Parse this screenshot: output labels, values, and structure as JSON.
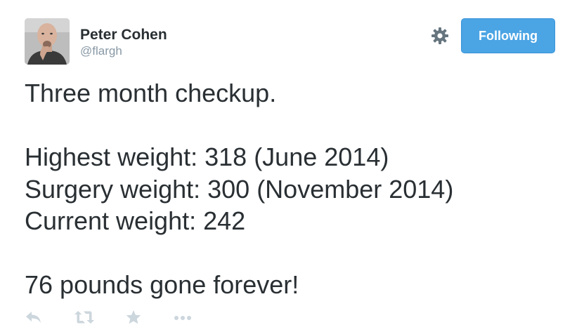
{
  "user": {
    "name": "Peter Cohen",
    "handle": "@flargh"
  },
  "header": {
    "follow_label": "Following",
    "settings_icon": "gear-icon",
    "accent": "#4ba4e4"
  },
  "tweet": {
    "lines": [
      "Three month checkup.",
      "",
      "Highest weight: 318 (June 2014)",
      "Surgery weight: 300 (November 2014)",
      "Current weight: 242",
      "",
      "76 pounds gone forever!"
    ]
  },
  "actions": [
    {
      "name": "reply-icon"
    },
    {
      "name": "retweet-icon"
    },
    {
      "name": "favorite-icon"
    },
    {
      "name": "more-icon"
    }
  ]
}
